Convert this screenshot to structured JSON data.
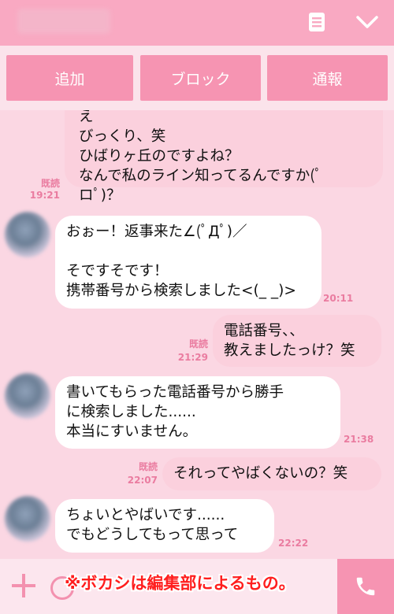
{
  "header": {
    "contact_name": "生原 雄介",
    "menu_icon": "document-menu-icon",
    "collapse_icon": "chevron-down-icon"
  },
  "actions": {
    "add_label": "追加",
    "block_label": "ブロック",
    "report_label": "通報"
  },
  "messages": [
    {
      "side": "out",
      "text": "え\nびっくり、笑\nひばりヶ丘のですよね？\nなんで私のライン知ってるんですか(ﾟ\nロﾟ)？",
      "read": "既読",
      "time": "19:21"
    },
    {
      "side": "in",
      "text": "おぉー！返事来た∠(ﾟДﾟ)／\n\nそですそです！\n携帯番号から検索しました<(_ _)>",
      "time": "20:11"
    },
    {
      "side": "out",
      "text": "電話番号、、\n教えましたっけ？笑",
      "read": "既読",
      "time": "21:29"
    },
    {
      "side": "in",
      "text": "書いてもらった電話番号から勝手\nに検索しました......\n本当にすいません。",
      "time": "21:38"
    },
    {
      "side": "out",
      "text": "それってやばくないの？笑",
      "read": "既読",
      "time": "22:07"
    },
    {
      "side": "in",
      "text": "ちょいとやばいです......\nでもどうしてもって思って",
      "time": "22:22"
    }
  ],
  "footer": {
    "plus_icon": "plus-icon",
    "call_icon": "phone-icon",
    "caption": "※ボカシは編集部によるもの。"
  },
  "colors": {
    "header": "#f9a9c2",
    "action_button": "#f694b2",
    "chat_background": "#fbd7e3",
    "sent_bubble": "#fbd0dd",
    "received_bubble": "#ffffff",
    "meta_text": "#ea7ca0",
    "caption_text": "#ff1e1e"
  }
}
